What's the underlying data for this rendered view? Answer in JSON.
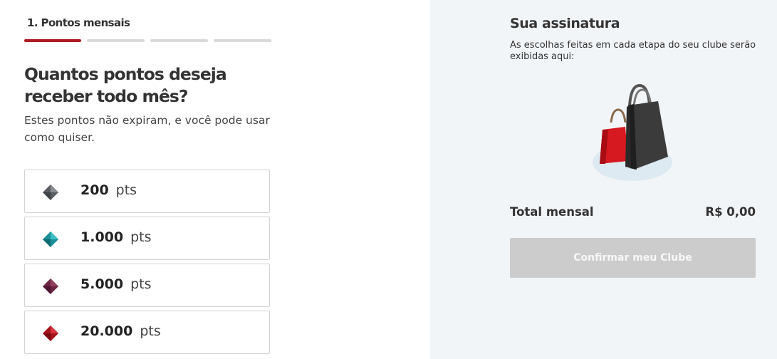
{
  "steps": {
    "current_label": "1. Pontos mensais",
    "total": 4,
    "current": 1
  },
  "question": {
    "title": "Quantos pontos deseja receber todo mês?",
    "subtitle": "Estes pontos não expiram, e você pode usar como quiser."
  },
  "options": [
    {
      "value": "200",
      "unit": "pts",
      "icon": "gray-gem-icon",
      "color": "#5a5e63"
    },
    {
      "value": "1.000",
      "unit": "pts",
      "icon": "teal-gem-icon",
      "color": "#1a8f9a"
    },
    {
      "value": "5.000",
      "unit": "pts",
      "icon": "purple-gem-icon",
      "color": "#6b2544"
    },
    {
      "value": "20.000",
      "unit": "pts",
      "icon": "red-gem-icon",
      "color": "#a8141c"
    }
  ],
  "summary": {
    "title": "Sua assinatura",
    "description": "As escolhas feitas em cada etapa do seu clube serão exibidas aqui:",
    "illustration": "shopping-bags-icon",
    "total_label": "Total mensal",
    "total_value": "R$ 0,00",
    "confirm_label": "Confirmar meu Clube"
  },
  "colors": {
    "accent": "#b01c24",
    "panel_bg": "#f2f5f8",
    "button_disabled": "#cccccc"
  }
}
